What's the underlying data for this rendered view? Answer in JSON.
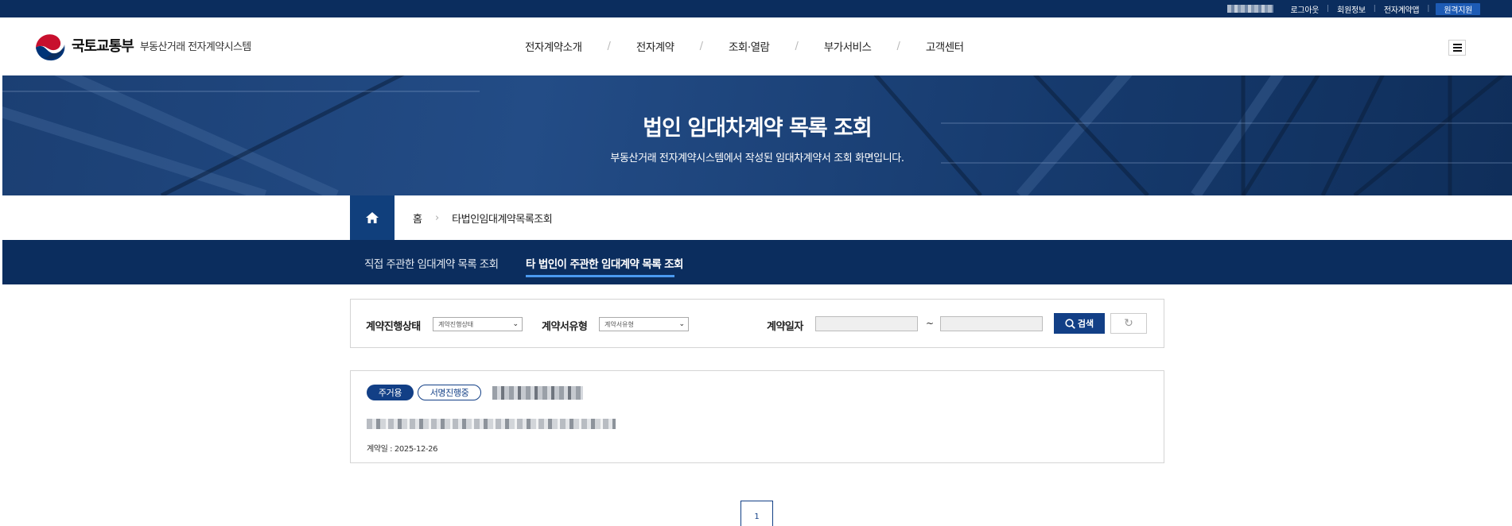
{
  "topbar": {
    "links": [
      "로그아웃",
      "회원정보",
      "전자계약앱"
    ],
    "remote_support": "원격지원"
  },
  "header": {
    "ministry": "국토교통부",
    "system_name": "부동산거래 전자계약시스템",
    "gnb": [
      "전자계약소개",
      "전자계약",
      "조회·열람",
      "부가서비스",
      "고객센터"
    ],
    "menu_icon": "hamburger-icon"
  },
  "hero": {
    "title": "법인 임대차계약 목록 조회",
    "subtitle": "부동산거래 전자계약시스템에서 작성된 임대차계약서 조회 화면입니다."
  },
  "breadcrumb": {
    "home_icon": "home-icon",
    "items": [
      "홈",
      "타법인임대계약목록조회"
    ]
  },
  "tabs": [
    {
      "label": "직접 주관한 임대계약 목록 조회",
      "active": false
    },
    {
      "label": "타 법인이 주관한 임대계약 목록 조회",
      "active": true
    }
  ],
  "search": {
    "status_label": "계약진행상태",
    "status_value": "계약진행상태",
    "type_label": "계약서유형",
    "type_value": "계약서유형",
    "date_label": "계약일자",
    "date_sep": "~",
    "search_button": "검색",
    "reset_icon": "refresh-icon"
  },
  "results": [
    {
      "badges": [
        "주거용",
        "서명진행중"
      ],
      "date_text": "계약일 : 2025-12-26"
    }
  ],
  "pagination": {
    "current": "1"
  },
  "colors": {
    "navy": "#0b2d5e",
    "accent": "#123f86",
    "tab_underline": "#4b9af0"
  }
}
